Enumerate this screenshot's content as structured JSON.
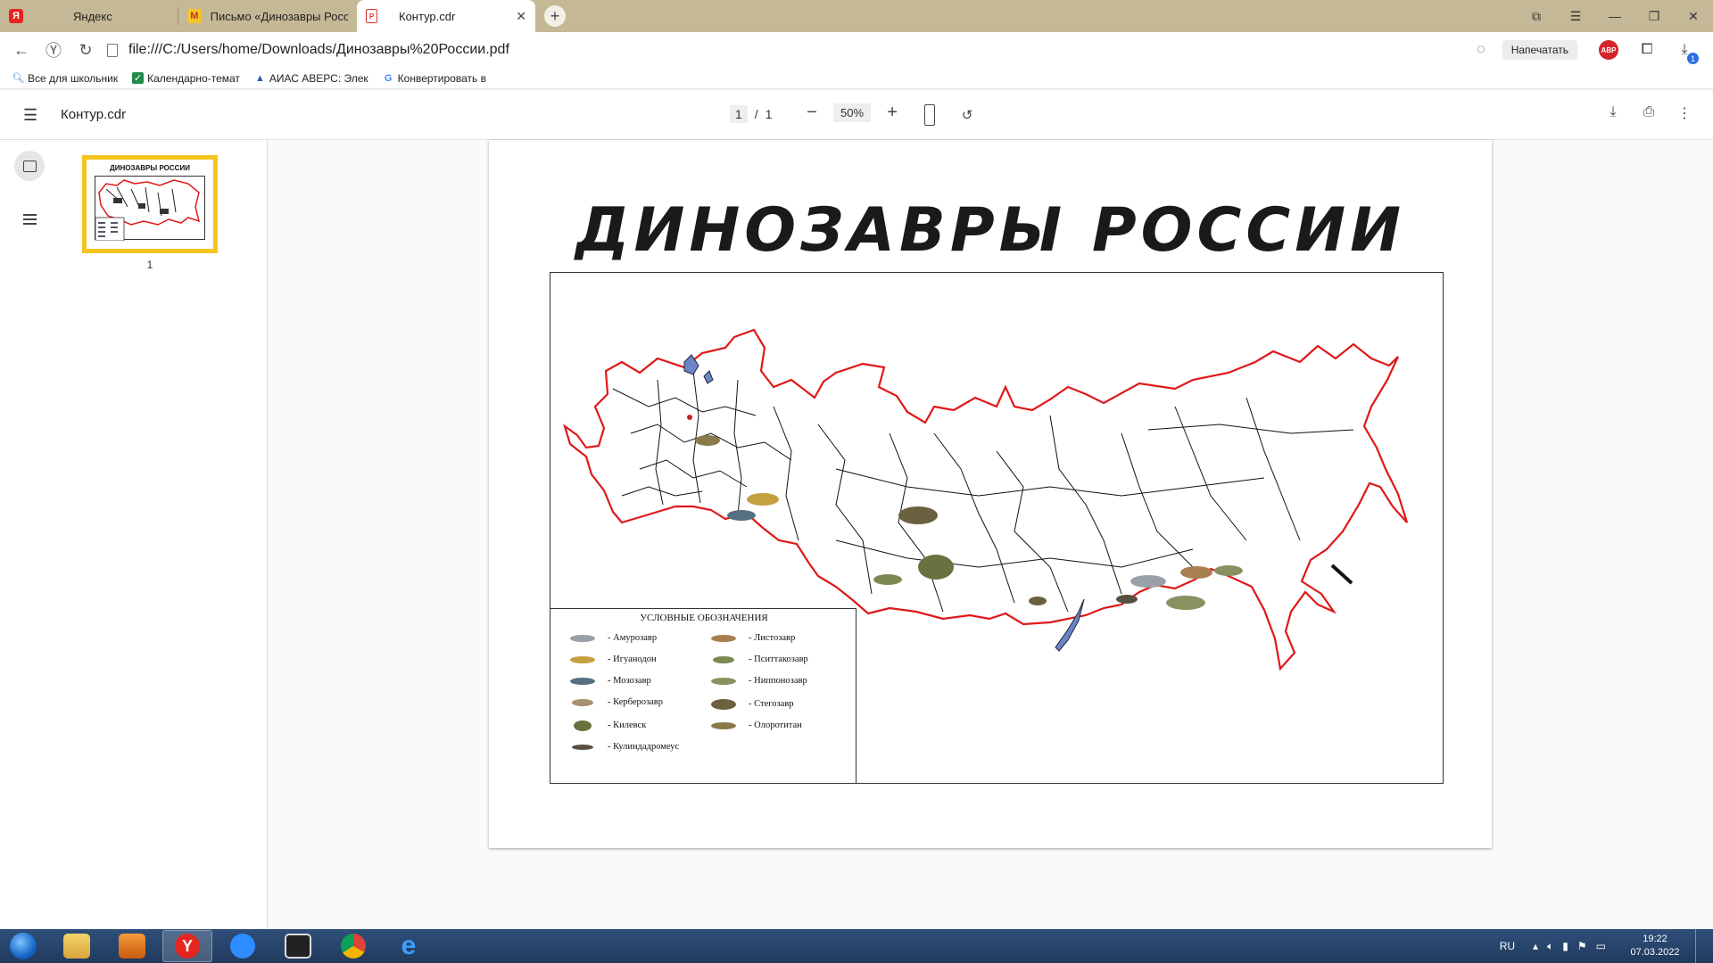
{
  "tabs": [
    {
      "label": "Яндекс",
      "icon": "yandex-icon",
      "active": false
    },
    {
      "label": "Письмо «Динозавры Росс",
      "icon": "mail-icon",
      "active": false
    },
    {
      "label": "Контур.cdr",
      "icon": "pdf-icon",
      "active": true
    }
  ],
  "address": {
    "url": "file:///C:/Users/home/Downloads/Динозавры%20России.pdf",
    "print_label": "Напечатать",
    "abp_label": "ABP",
    "downloads_count": "1"
  },
  "bookmarks": [
    {
      "label": "Все для школьник",
      "icon": "search-icon"
    },
    {
      "label": "Календарно-темат",
      "icon": "checkbox-icon"
    },
    {
      "label": "АИАС АВЕРС: Элек",
      "icon": "triangle-logo-icon"
    },
    {
      "label": "Конвертировать в",
      "icon": "google-icon"
    }
  ],
  "pdf": {
    "title": "Контур.cdr",
    "page_current": "1",
    "page_separator": "/",
    "page_total": "1",
    "zoom": "50%",
    "thumb_number": "1",
    "thumb_title": "ДИНОЗАВРЫ РОССИИ"
  },
  "document": {
    "title": "ДИНОЗАВРЫ РОССИИ",
    "legend_title": "УСЛОВНЫЕ ОБОЗНАЧЕНИЯ",
    "legend_left": [
      "- Амурозавр",
      "- Игуанодон",
      "- Мозозавр",
      "- Керберозавр",
      "- Килевск",
      "- Кулиндадромеус"
    ],
    "legend_right": [
      "- Листозавр",
      "- Пситтакозавр",
      "- Ниппонозавр",
      "- Стегозавр",
      "- Олоротитан"
    ]
  },
  "taskbar": {
    "lang": "RU",
    "time": "19:22",
    "date": "07.03.2022",
    "apps": [
      "explorer",
      "media-player",
      "yandex-browser",
      "zoom",
      "video-editor",
      "chrome",
      "internet-explorer"
    ]
  },
  "colors": {
    "map_border": "#e01818",
    "tab_bar": "#c4b896",
    "thumb_highlight": "#f4c41d",
    "taskbar": "#203a5e"
  }
}
